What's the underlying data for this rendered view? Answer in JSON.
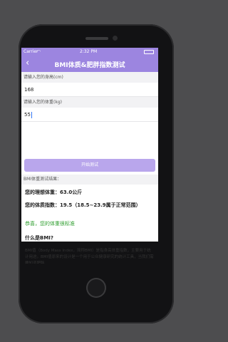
{
  "status": {
    "carrier": "Carrier",
    "time": "2:32 PM"
  },
  "nav": {
    "back": "‹",
    "title": "BMI体质&肥胖指数测试"
  },
  "form": {
    "height_label": "请输入您的身高(cm)",
    "height_value": "168",
    "weight_label": "请输入您的体重(kg)",
    "weight_value": "55"
  },
  "button": {
    "label": "开始测试"
  },
  "result": {
    "section": "BMI体重测试结果：",
    "ideal_weight": "您的理想体重：63.0公斤",
    "bmi_line": "您的体质指数：19.5（18.5~23.9属于正常范围）",
    "congrats": "恭喜，您的体重很标准"
  },
  "info": {
    "heading": "什么是BMI?",
    "body": "BMI值（Body Mass Index，简称BMI）是指身高体重指数，主要用于统计用途。BMI值原来的设计是一个用于公众健康研究的统计工具，当我们需要知道肥胖"
  },
  "colors": {
    "accent": "#9c85e0",
    "button": "#b9a6ec",
    "success": "#2f9e2f"
  }
}
